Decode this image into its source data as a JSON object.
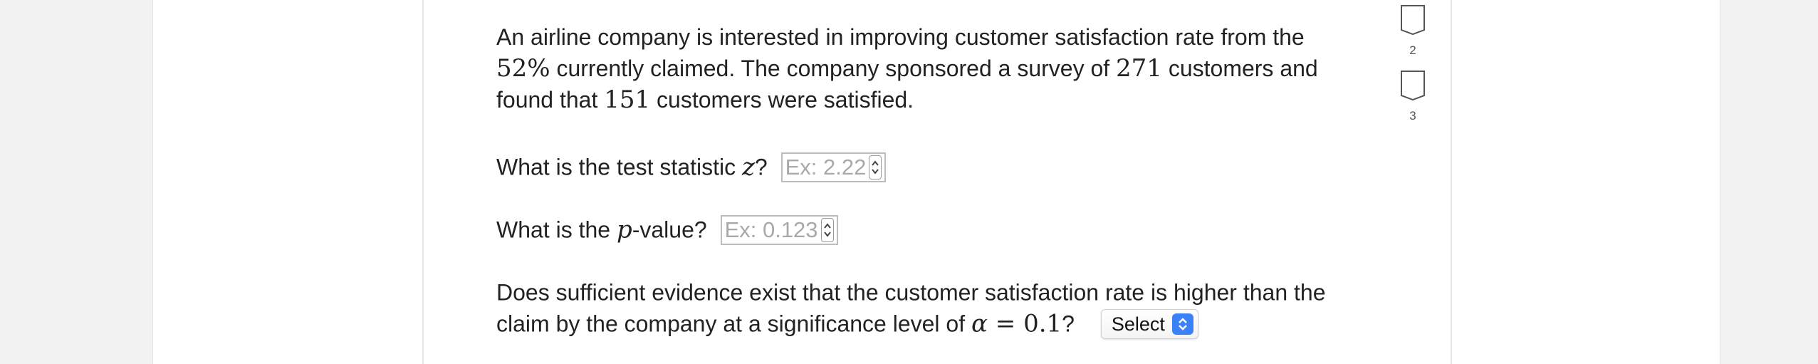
{
  "question": {
    "intro": {
      "t1": "An airline company is interested in improving customer satisfaction rate from the",
      "m1": "52%",
      "t2": " currently claimed. The company sponsored a survey of ",
      "m2": "271",
      "t3": " customers and",
      "t4": "found that ",
      "m3": "151",
      "t5": " customers were satisfied."
    },
    "q1": {
      "t1": "What is the test statistic ",
      "var": "z",
      "t2": "?",
      "placeholder": "Ex: 2.22"
    },
    "q2": {
      "t1": "What is the ",
      "var": "p",
      "t2": "-value?",
      "placeholder": "Ex: 0.123"
    },
    "q3": {
      "line1": "Does sufficient evidence exist that the customer satisfaction rate is higher than the",
      "line2": "claim by the company at a significance level of ",
      "alpha": "α",
      "eq": " = 0.1",
      "t_end": "?",
      "select_label": "Select"
    }
  },
  "side_flags": [
    {
      "number": "2"
    },
    {
      "number": "3"
    }
  ],
  "colors": {
    "page_bg": "#f2f2f2",
    "panel_bg": "#ffffff",
    "select_accent": "#3b82f6",
    "placeholder": "#a9a9a9"
  },
  "icons": {
    "flag": "bookmark-flag-icon",
    "spinner": "spinner-arrows-icon",
    "select": "select-chevrons-icon"
  }
}
